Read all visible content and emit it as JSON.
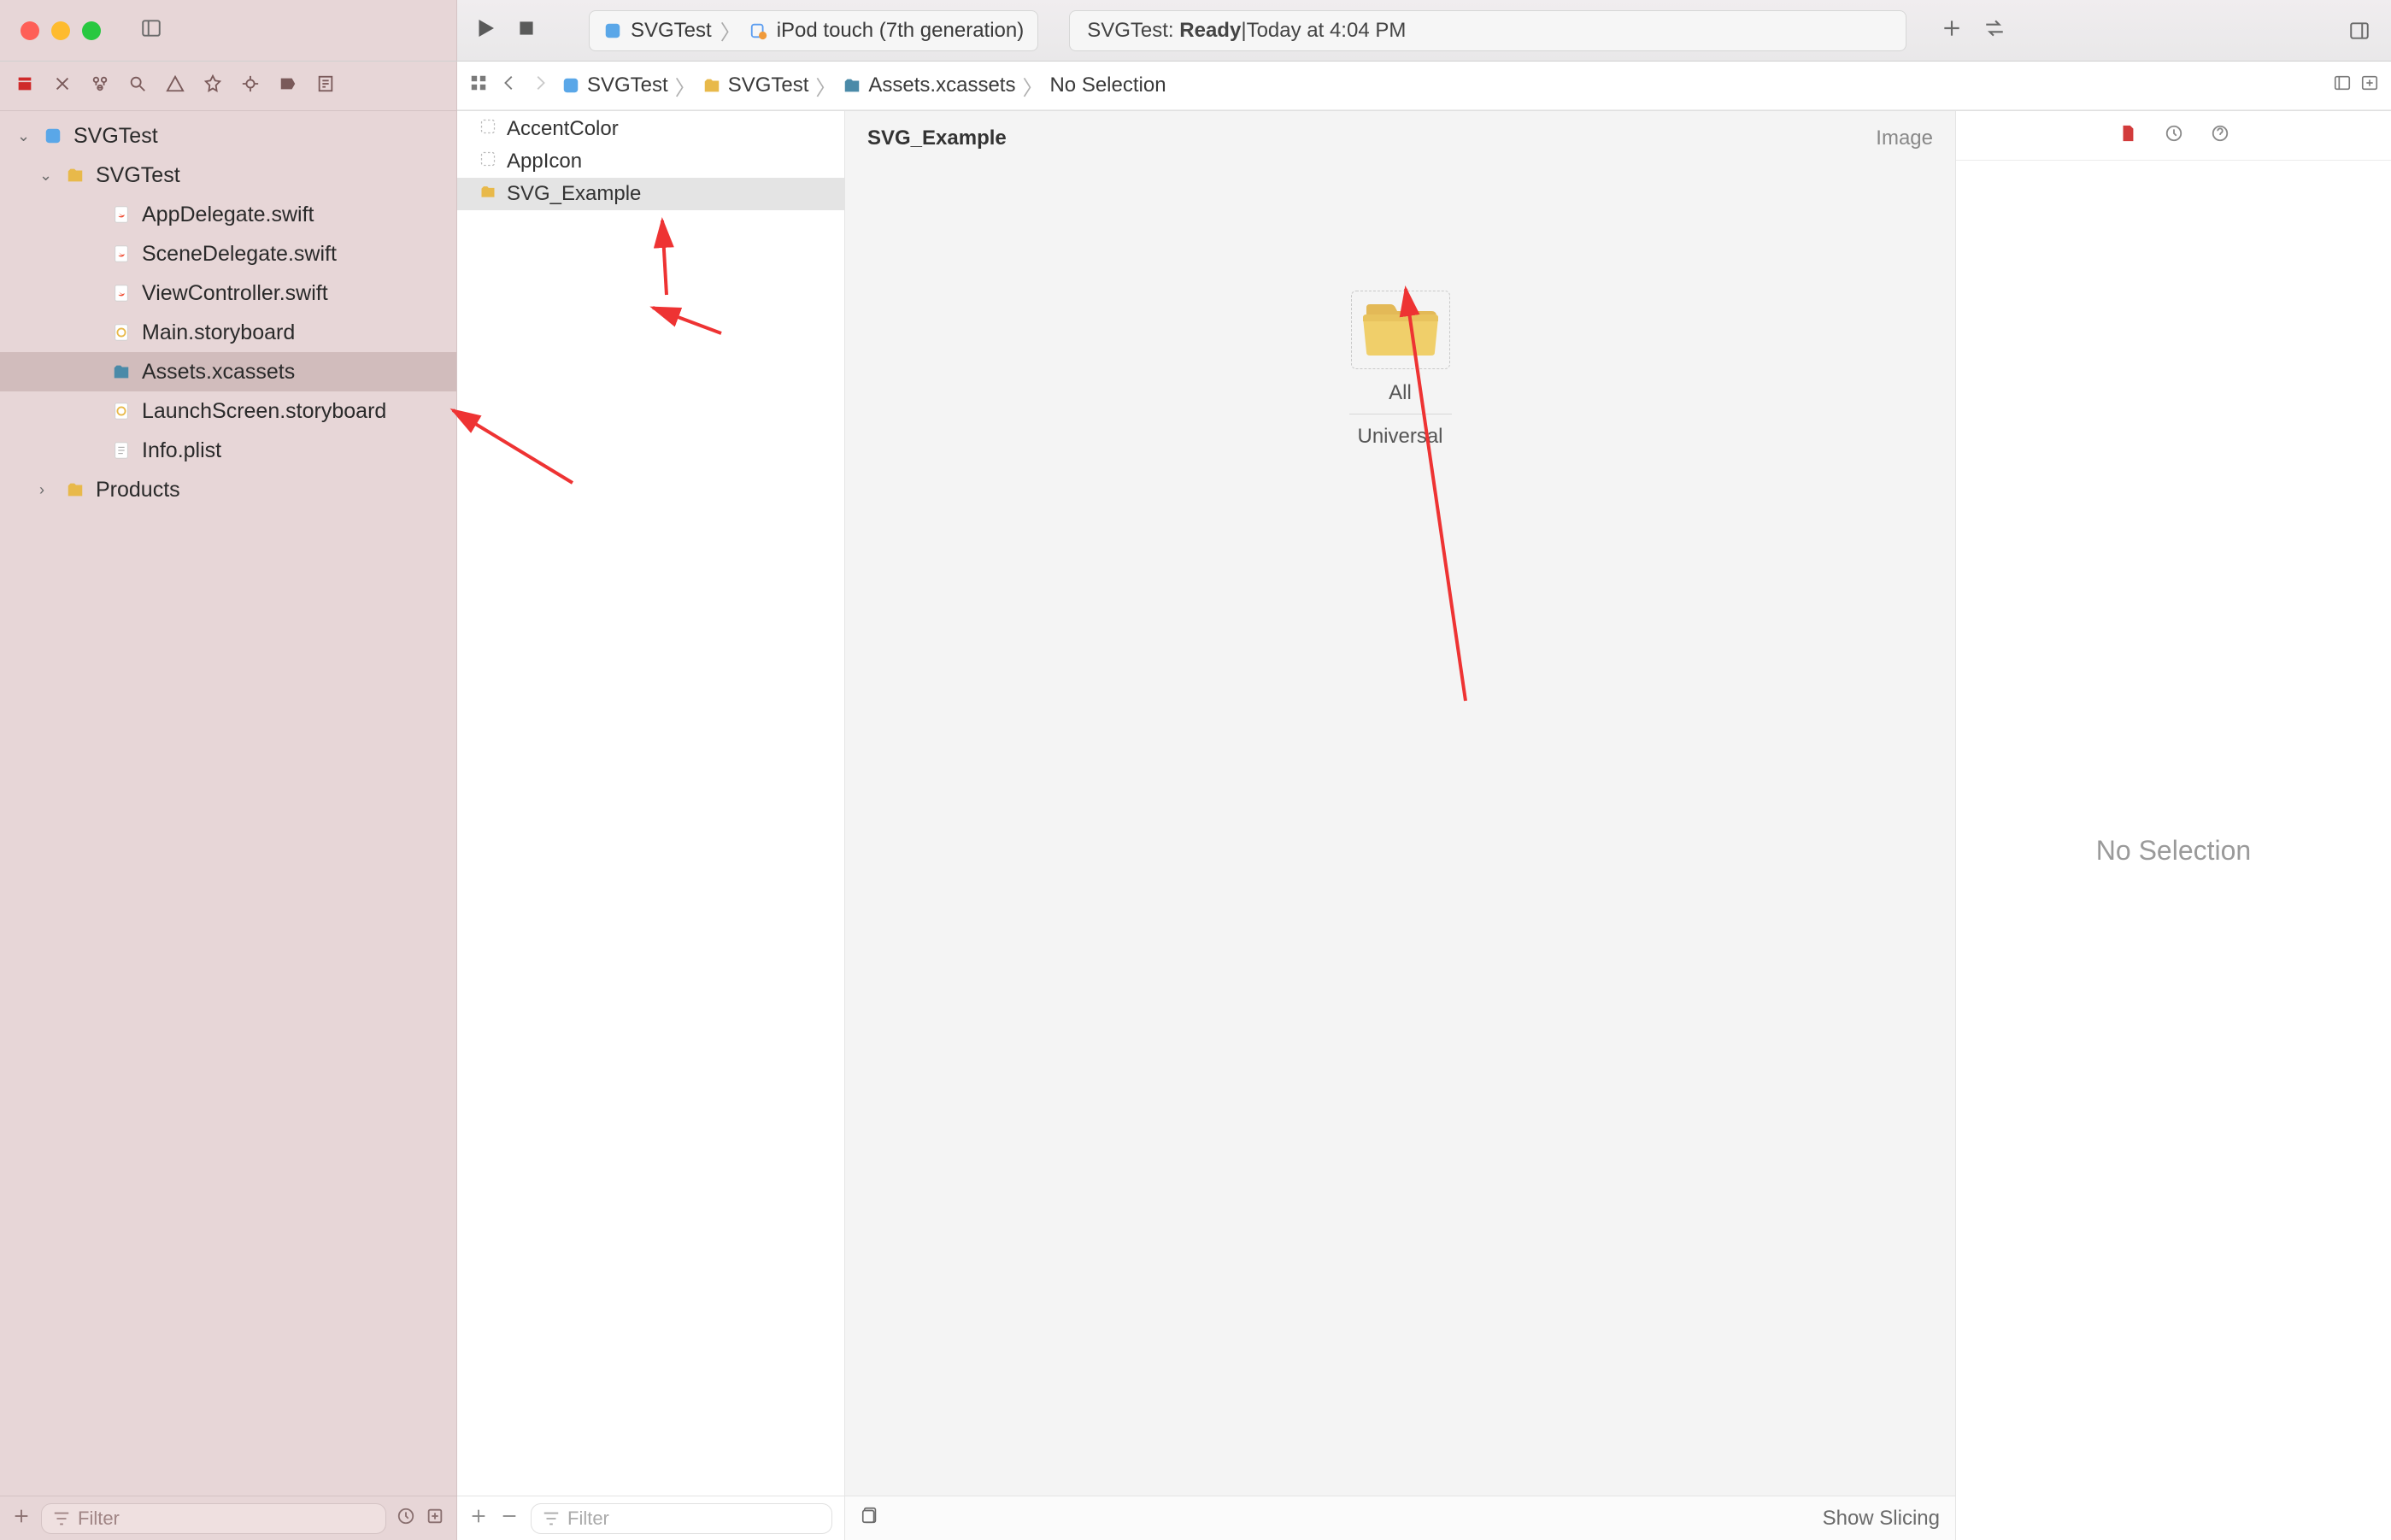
{
  "titlebar": {
    "scheme_target": "SVGTest",
    "device": "iPod touch (7th generation)",
    "status_project": "SVGTest:",
    "status_state": "Ready",
    "status_sep": " | ",
    "status_time": "Today at 4:04 PM"
  },
  "pathbar": {
    "items": [
      "SVGTest",
      "SVGTest",
      "Assets.xcassets",
      "No Selection"
    ]
  },
  "navigator": {
    "root": "SVGTest",
    "group": "SVGTest",
    "files": [
      "AppDelegate.swift",
      "SceneDelegate.swift",
      "ViewController.swift",
      "Main.storyboard",
      "Assets.xcassets",
      "LaunchScreen.storyboard",
      "Info.plist"
    ],
    "products": "Products",
    "selected_index": 4,
    "filter_placeholder": "Filter"
  },
  "assets": {
    "items": [
      "AccentColor",
      "AppIcon",
      "SVG_Example"
    ],
    "selected_index": 2,
    "filter_placeholder": "Filter"
  },
  "canvas": {
    "title": "SVG_Example",
    "kind": "Image",
    "well_label": "All",
    "well_sub": "Universal",
    "show_slicing": "Show Slicing"
  },
  "inspector": {
    "no_selection": "No Selection"
  }
}
